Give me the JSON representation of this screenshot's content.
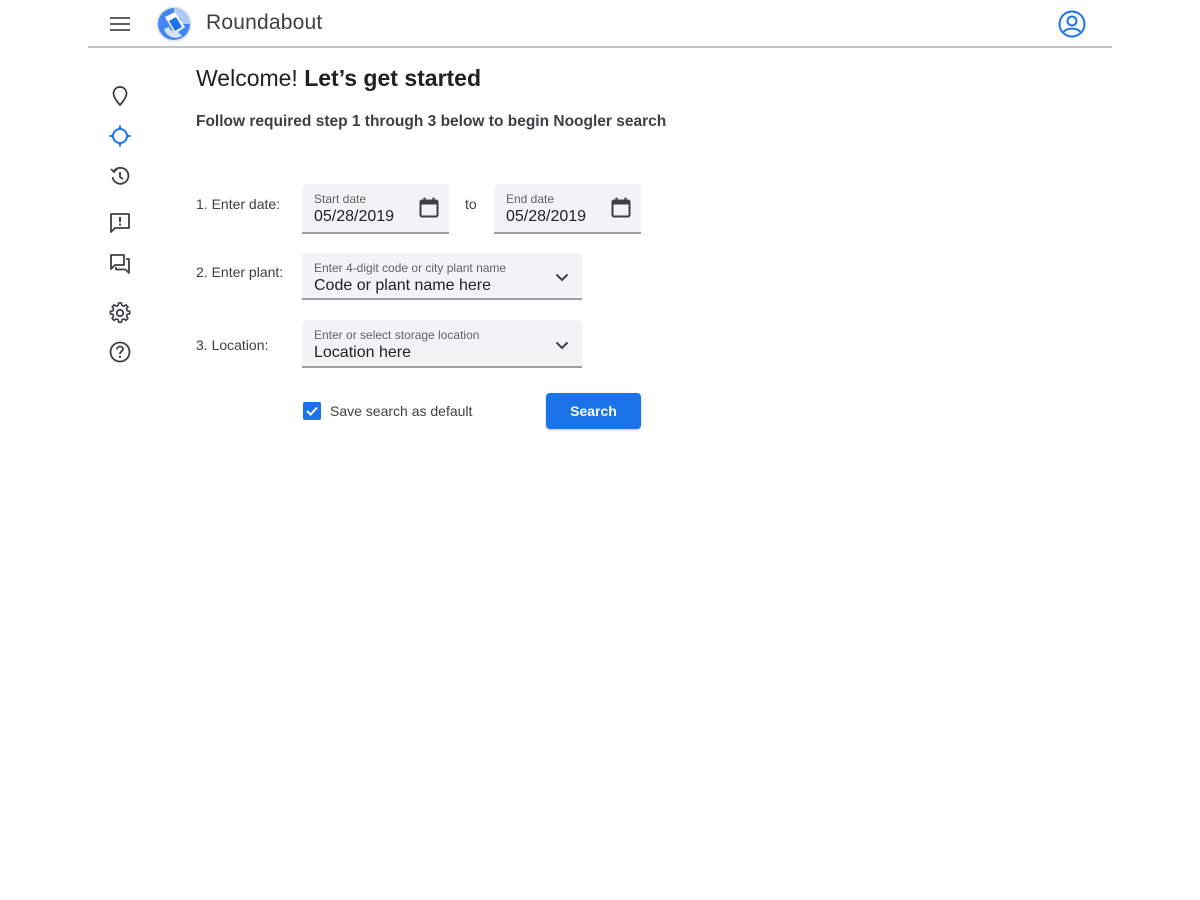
{
  "app": {
    "title": "Roundabout",
    "accent_color": "#1a73e8"
  },
  "header": {
    "menu_icon": "hamburger-menu-icon",
    "logo_icon": "roundabout-logo-icon",
    "account_icon": "account-circle-icon"
  },
  "nav_rail": {
    "items": [
      {
        "icon": "location-pin-icon",
        "active": false
      },
      {
        "icon": "crosshair-target-icon",
        "active": true
      },
      {
        "icon": "history-icon",
        "active": false
      },
      {
        "icon": "feedback-icon",
        "active": false
      },
      {
        "icon": "forum-icon",
        "active": false
      },
      {
        "icon": "settings-gear-icon",
        "active": false
      },
      {
        "icon": "help-icon",
        "active": false
      }
    ]
  },
  "welcome": {
    "greeting": "Welcome!",
    "emphasis": "Let’s get started"
  },
  "subtitle": "Follow required step 1 through 3 below to begin Noogler search",
  "steps": {
    "date": {
      "label": "1. Enter date:",
      "start": {
        "label": "Start date",
        "value": "05/28/2019"
      },
      "separator": "to",
      "end": {
        "label": "End date",
        "value": "05/28/2019"
      }
    },
    "plant": {
      "label": "2. Enter plant:",
      "field_label": "Enter 4-digit code or city plant name",
      "placeholder": "Code or plant name here"
    },
    "location": {
      "label": "3. Location:",
      "field_label": "Enter or select storage location",
      "placeholder": "Location here"
    }
  },
  "save_default": {
    "label": "Save search as default",
    "checked": true
  },
  "search_button": "Search"
}
